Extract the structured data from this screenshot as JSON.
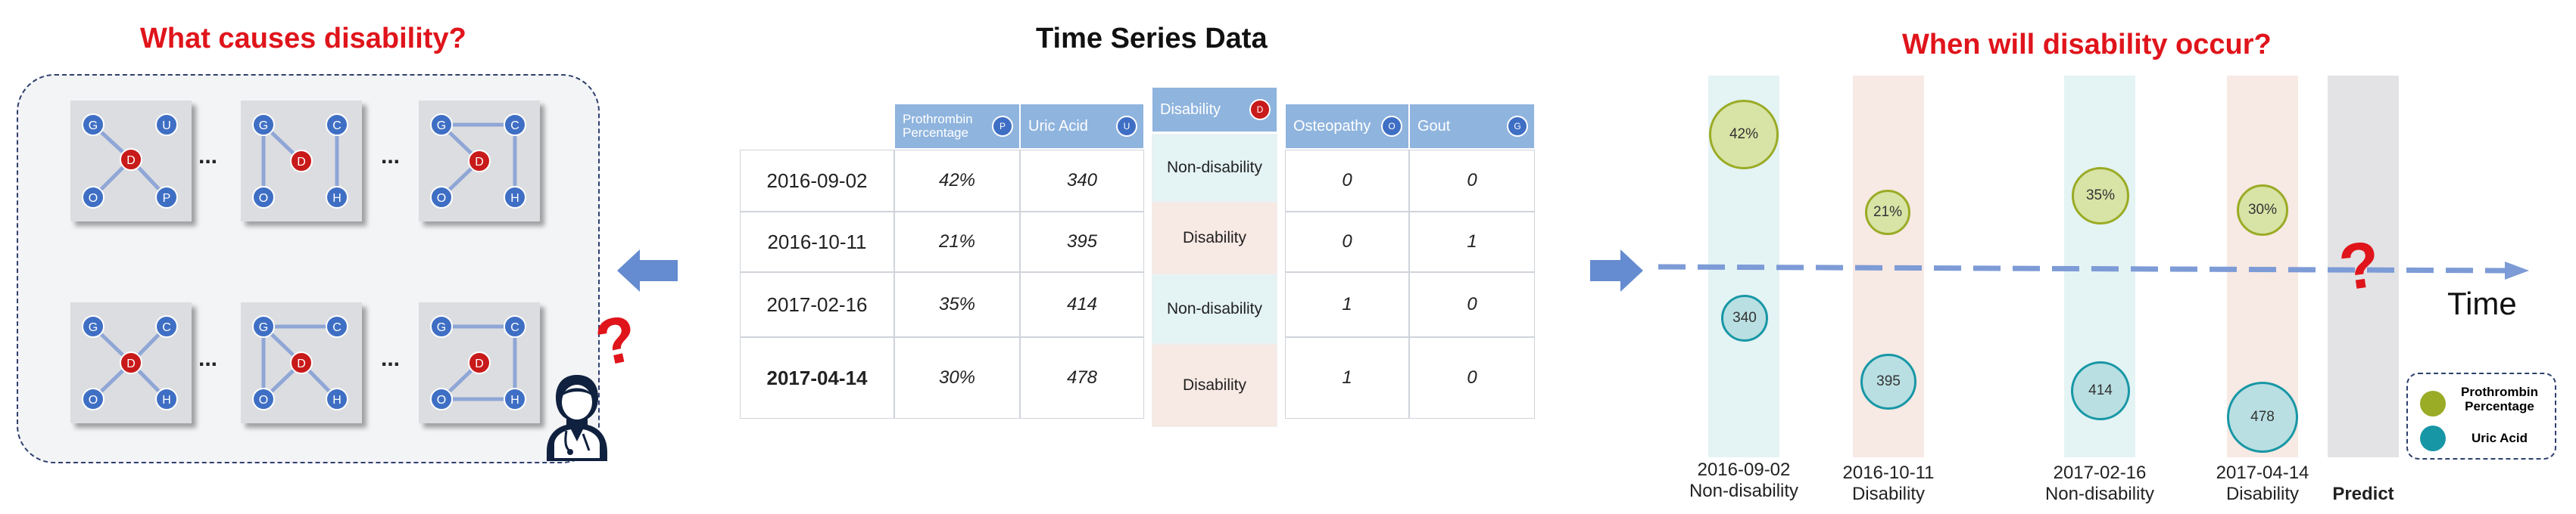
{
  "left": {
    "title": "What causes disability?",
    "node_labels": {
      "G": "G",
      "U": "U",
      "D": "D",
      "O": "O",
      "P": "P",
      "C": "C",
      "H": "H"
    },
    "ellipsis": "..."
  },
  "middle": {
    "title": "Time Series Data",
    "columns": [
      {
        "label": "Prothrombin Percentage",
        "badge": "P"
      },
      {
        "label": "Uric Acid",
        "badge": "U"
      },
      {
        "label": "Disability",
        "badge": "D"
      },
      {
        "label": "Osteopathy",
        "badge": "O"
      },
      {
        "label": "Gout",
        "badge": "G"
      }
    ],
    "rows": [
      {
        "date": "2016-09-02",
        "prothrombin": "42%",
        "uric": "340",
        "disability": "Non-disability",
        "osteopathy": "0",
        "gout": "0"
      },
      {
        "date": "2016-10-11",
        "prothrombin": "21%",
        "uric": "395",
        "disability": "Disability",
        "osteopathy": "0",
        "gout": "1"
      },
      {
        "date": "2017-02-16",
        "prothrombin": "35%",
        "uric": "414",
        "disability": "Non-disability",
        "osteopathy": "1",
        "gout": "0"
      },
      {
        "date": "2017-04-14",
        "prothrombin": "30%",
        "uric": "478",
        "disability": "Disability",
        "osteopathy": "1",
        "gout": "0"
      }
    ]
  },
  "right": {
    "title": "When will disability occur?",
    "time_label": "Time",
    "question_mark": "?",
    "points": [
      {
        "date": "2016-09-02",
        "status": "Non-disability",
        "prothrombin": "42%",
        "uric": "340"
      },
      {
        "date": "2016-10-11",
        "status": "Disability",
        "prothrombin": "21%",
        "uric": "395"
      },
      {
        "date": "2017-02-16",
        "status": "Non-disability",
        "prothrombin": "35%",
        "uric": "414"
      },
      {
        "date": "2017-04-14",
        "status": "Disability",
        "prothrombin": "30%",
        "uric": "478"
      }
    ],
    "predict_label": "Predict",
    "legend": [
      {
        "label": "Prothrombin Percentage",
        "color": "#9aab25"
      },
      {
        "label": "Uric Acid",
        "color": "#1797a6"
      }
    ]
  },
  "colors": {
    "title_red": "#e0141b",
    "node_blue": "#3f6fc4",
    "node_red": "#c81a1a",
    "header_blue": "#8fb4de",
    "nondisability_bg": "#e4f3f4",
    "disability_bg": "#f7e9e3",
    "arrow_blue": "#4a78c8"
  }
}
